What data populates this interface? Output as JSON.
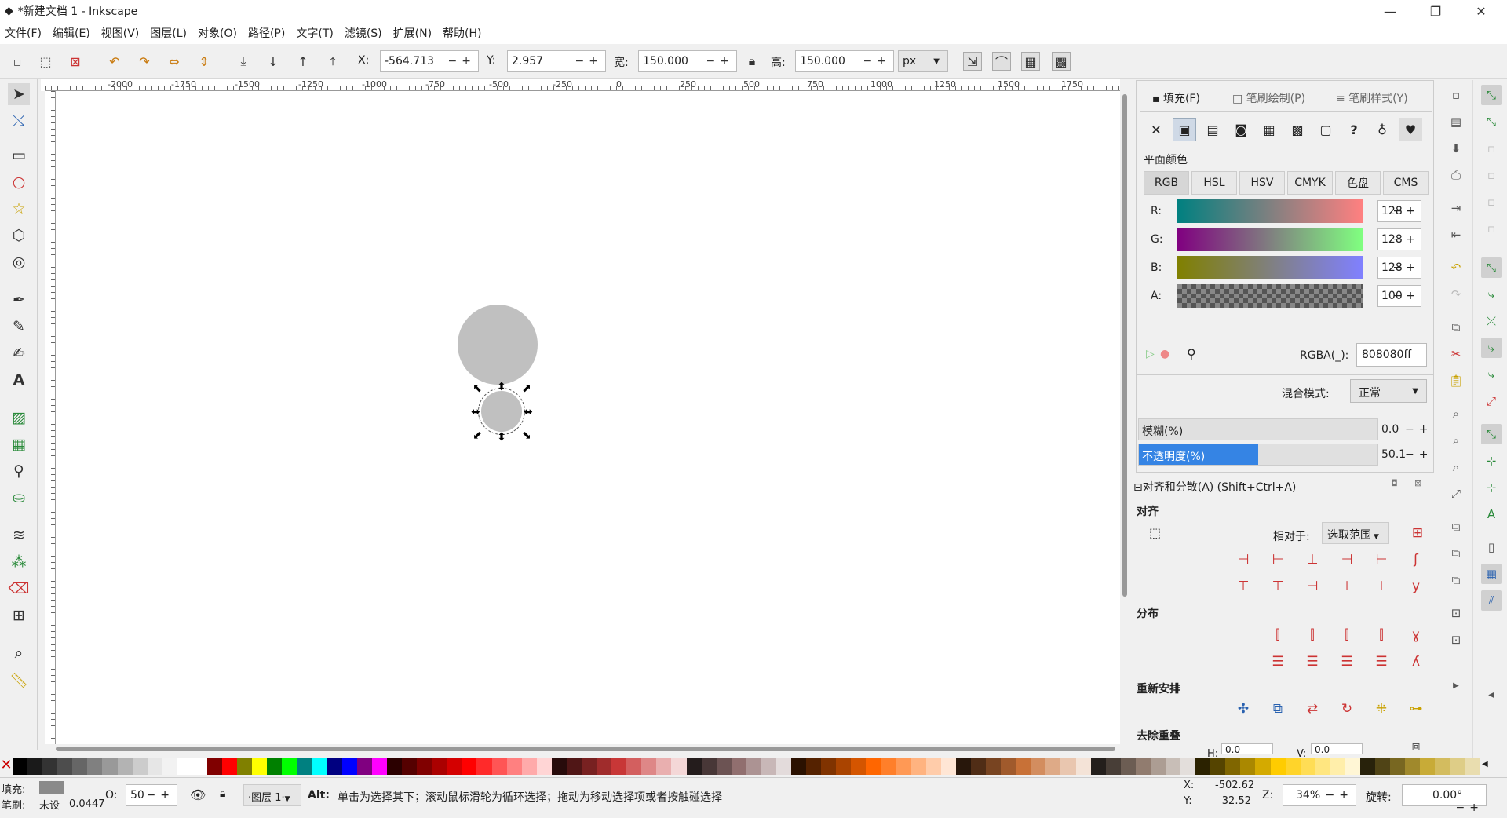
{
  "window": {
    "title": "*新建文档 1 - Inkscape",
    "minimize": "—",
    "maximize": "❐",
    "close": "✕"
  },
  "menu": [
    "文件(F)",
    "编辑(E)",
    "视图(V)",
    "图层(L)",
    "对象(O)",
    "路径(P)",
    "文字(T)",
    "滤镜(S)",
    "扩展(N)",
    "帮助(H)"
  ],
  "selectbar": {
    "x_label": "X:",
    "x_value": "-564.713",
    "y_label": "Y:",
    "y_value": "2.957",
    "w_label": "宽:",
    "w_value": "150.000",
    "h_label": "高:",
    "h_value": "150.000",
    "unit": "px"
  },
  "rulers": {
    "h_ticks": [
      "-2000",
      "-1750",
      "-1500",
      "-1250",
      "-1000",
      "-750",
      "-500",
      "-250",
      "0",
      "250",
      "500",
      "750",
      "1000",
      "1250",
      "1500",
      "1750"
    ],
    "v_ticks": [
      "1",
      "5",
      "0",
      "7",
      "5",
      "0",
      "2",
      "5",
      "0",
      "5",
      "0",
      "0",
      "2",
      "5",
      "0"
    ]
  },
  "fill": {
    "tabs": [
      "填充(F)",
      "笔刷绘制(P)",
      "笔刷样式(Y)"
    ],
    "mode_icons": [
      "no-paint",
      "flat-color",
      "linear-gradient",
      "radial-gradient",
      "mesh-gradient",
      "pattern",
      "swatch",
      "unset",
      "evenodd",
      "nonzero"
    ],
    "section": "平面颜色",
    "color_modes": [
      "RGB",
      "HSL",
      "HSV",
      "CMYK",
      "色盘",
      "CMS"
    ],
    "channels": [
      {
        "label": "R:",
        "value": "128",
        "grad_start": "#008080",
        "grad_end": "#ff8080"
      },
      {
        "label": "G:",
        "value": "128",
        "grad_start": "#800080",
        "grad_end": "#80ff80"
      },
      {
        "label": "B:",
        "value": "128",
        "grad_start": "#808000",
        "grad_end": "#8080ff"
      },
      {
        "label": "A:",
        "value": "100"
      }
    ],
    "rgba_label": "RGBA(_):",
    "rgba_value": "808080ff",
    "blend_label": "混合模式:",
    "blend_value": "正常",
    "blur_label": "模糊(%)",
    "blur_value": "0.0",
    "opacity_label": "不透明度(%)",
    "opacity_value": "50.1",
    "opacity_fraction": 0.501
  },
  "align": {
    "title": "对齐和分散(A) (Shift+Ctrl+A)",
    "align_section": "对齐",
    "relative_label": "相对于:",
    "relative_value": "选取范围",
    "distribute_section": "分布",
    "rearrange_section": "重新安排",
    "remove_overlap_section": "去除重叠",
    "h_label": "H:",
    "h_value": "0.0",
    "v_label": "V:",
    "v_value": "0.0"
  },
  "status": {
    "fill_label": "填充:",
    "stroke_label": "笔刷:",
    "stroke_value": "未设",
    "stroke_width": "0.0447",
    "opacity_label": "O:",
    "opacity_value": "50",
    "layer": "·图层 1·",
    "message_bold": "Alt:",
    "message": "单击为选择其下；滚动鼠标滑轮为循环选择；拖动为移动选择项或者按触碰选择",
    "x_label": "X:",
    "x_value": "-502.62",
    "y_label": "Y:",
    "y_value": "32.52",
    "zoom_label": "Z:",
    "zoom_value": "34%",
    "rotate_label": "旋转:",
    "rotate_value": "0.00°"
  },
  "colors": {
    "object": "#c0c0c0",
    "palette": [
      "#000000",
      "#1a1a1a",
      "#333333",
      "#4d4d4d",
      "#666666",
      "#808080",
      "#999999",
      "#b3b3b3",
      "#cccccc",
      "#e6e6e6",
      "#f2f2f2",
      "#ffffff",
      "#ffffff",
      "#800000",
      "#ff0000",
      "#808000",
      "#ffff00",
      "#008000",
      "#00ff00",
      "#008080",
      "#00ffff",
      "#000080",
      "#0000ff",
      "#800080",
      "#ff00ff",
      "#2b0000",
      "#550000",
      "#800000",
      "#aa0000",
      "#d40000",
      "#ff0000",
      "#ff2a2a",
      "#ff5555",
      "#ff8080",
      "#ffaaaa",
      "#ffd5d5",
      "#280b0b",
      "#501616",
      "#782121",
      "#a02c2c",
      "#c83737",
      "#d35f5f",
      "#de8787",
      "#e9afaf",
      "#f4d7d7",
      "#241c1c",
      "#483737",
      "#6c5353",
      "#916f6f",
      "#ac9393",
      "#c8b7b7",
      "#e3dbdb",
      "#2b1100",
      "#552200",
      "#803300",
      "#aa4400",
      "#d45500",
      "#ff6600",
      "#ff7f2a",
      "#ff9955",
      "#ffb380",
      "#ffccaa",
      "#ffe6d5",
      "#28170b",
      "#502d16",
      "#784421",
      "#a05a2c",
      "#c87137",
      "#d38d5f",
      "#deaa87",
      "#e9c6af",
      "#f4e3d7",
      "#241f1c",
      "#483e37",
      "#6c5d53",
      "#917c6f",
      "#ac9d93",
      "#c8beb7",
      "#e3dedb",
      "#2b2200",
      "#554400",
      "#806600",
      "#aa8800",
      "#d4aa00",
      "#ffcc00",
      "#ffd42a",
      "#ffdd55",
      "#ffe680",
      "#ffeeaa",
      "#fff6d5",
      "#28220b",
      "#504416",
      "#786721",
      "#a0892c",
      "#c8ab37",
      "#d3bc5f",
      "#decd87",
      "#e9ddaf"
    ]
  }
}
